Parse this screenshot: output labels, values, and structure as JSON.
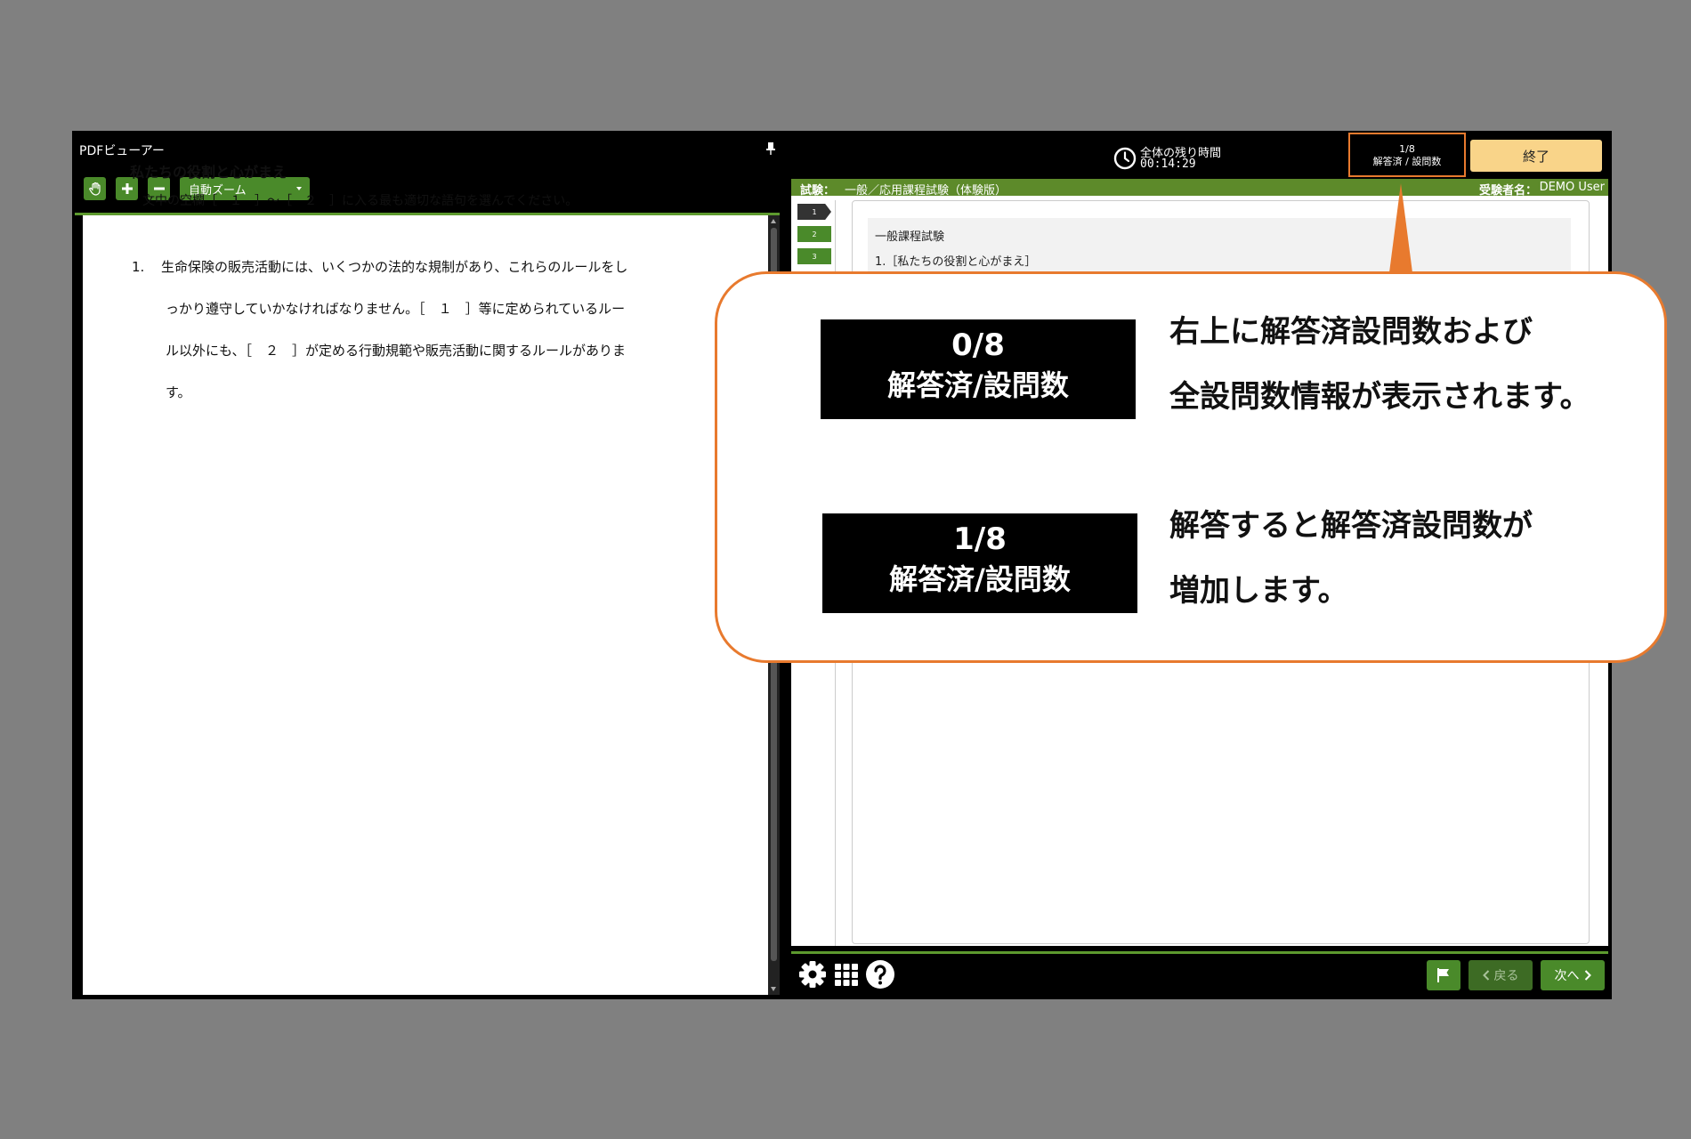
{
  "pdf": {
    "title": "PDFビューアー",
    "zoom": "自動ズーム",
    "heading": "私たちの役割と心がまえ",
    "instruction": "文中の空欄［　１　］～［　２　］に入る最も適切な語句を選んでください。",
    "question_number": "1.",
    "question_lines": [
      "生命保険の販売活動には、いくつかの法的な規制があり、これらのルールをし",
      "っかり遵守していかなければなりません。［　１　］等に定められているルー",
      "ル以外にも、［　２　］が定める行動規範や販売活動に関するルールがありま",
      "す。"
    ]
  },
  "header": {
    "timer_label": "全体の残り時間",
    "timer_value": "00:14:29",
    "count_value": "1/8",
    "count_label": "解答済 / 設問数",
    "finish_label": "終了"
  },
  "exam_bar": {
    "exam_label": "試験：",
    "exam_name": "一般／応用課程試験（体験版）",
    "user_label": "受験者名：",
    "user_name": "DEMO User"
  },
  "question_nav": [
    "1",
    "2",
    "3"
  ],
  "question": {
    "title": "一般課程試験",
    "subtitle": "1.［私たちの役割と心がまえ］"
  },
  "footer": {
    "back_label": "戻る",
    "next_label": "次へ"
  },
  "callout": {
    "before_value": "0/8",
    "before_label": "解答済/設問数",
    "caption1_line1": "右上に解答済設問数および",
    "caption1_line2": "全設問数情報が表示されます。",
    "after_value": "1/8",
    "after_label": "解答済/設問数",
    "caption2_line1": "解答すると解答済設問数が",
    "caption2_line2": "増加します。"
  },
  "colors": {
    "accent_green": "#4a8a2a",
    "highlight_orange": "#e87a2e",
    "finish_button": "#f9d489"
  }
}
